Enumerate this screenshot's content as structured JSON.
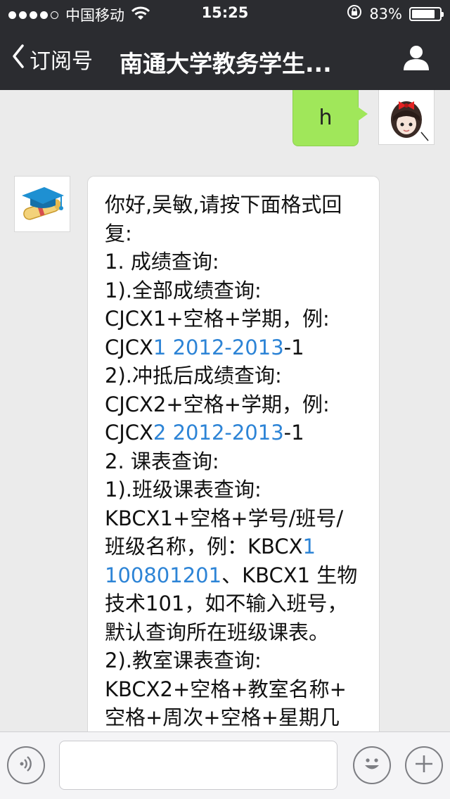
{
  "status_bar": {
    "carrier": "中国移动",
    "time": "15:25",
    "battery_percent": "83%",
    "battery_level": 0.83
  },
  "nav": {
    "back_label": "订阅号",
    "title": "南通大学教务学生..."
  },
  "messages": {
    "user": {
      "text": "h"
    },
    "bot": {
      "lines": [
        [
          {
            "t": "你好,吴敏,请按下面格式回"
          }
        ],
        [
          {
            "t": "复:"
          }
        ],
        [
          {
            "t": "1. 成绩查询:"
          }
        ],
        [
          {
            "t": "1).全部成绩查询:"
          }
        ],
        [
          {
            "t": "CJCX1+空格+学期，例:"
          }
        ],
        [
          {
            "t": "CJCX"
          },
          {
            "t": "1 2012-2013",
            "link": true
          },
          {
            "t": "-1"
          }
        ],
        [
          {
            "t": "2).冲抵后成绩查询:"
          }
        ],
        [
          {
            "t": "CJCX2+空格+学期，例:"
          }
        ],
        [
          {
            "t": "CJCX"
          },
          {
            "t": "2 2012-2013",
            "link": true
          },
          {
            "t": "-1"
          }
        ],
        [
          {
            "t": "2. 课表查询:"
          }
        ],
        [
          {
            "t": "1).班级课表查询:"
          }
        ],
        [
          {
            "t": "KBCX1+空格+学号/班号/"
          }
        ],
        [
          {
            "t": "班级名称，例：KBCX"
          },
          {
            "t": "1",
            "link": true
          }
        ],
        [
          {
            "t": "100801201",
            "link": true
          },
          {
            "t": "、KBCX1 生物"
          }
        ],
        [
          {
            "t": "技术101，如不输入班号，"
          }
        ],
        [
          {
            "t": "默认查询所在班级课表。"
          }
        ],
        [
          {
            "t": "2).教室课表查询:"
          }
        ],
        [
          {
            "t": "KBCX2+空格+教室名称+"
          }
        ],
        [
          {
            "t": "空格+周次+空格+星期几"
          }
        ]
      ]
    }
  },
  "input_bar": {
    "text": ""
  },
  "colors": {
    "nav_bg": "#2b2c30",
    "chat_bg": "#ebebeb",
    "user_bubble": "#a0e75a",
    "link": "#2d84d6"
  },
  "icons": {
    "back": "chevron-left-icon",
    "profile": "person-icon",
    "wifi": "wifi-icon",
    "rotation_lock": "rotation-lock-icon",
    "battery": "battery-icon",
    "voice": "voice-icon",
    "emoji": "emoji-icon",
    "plus": "plus-icon"
  }
}
